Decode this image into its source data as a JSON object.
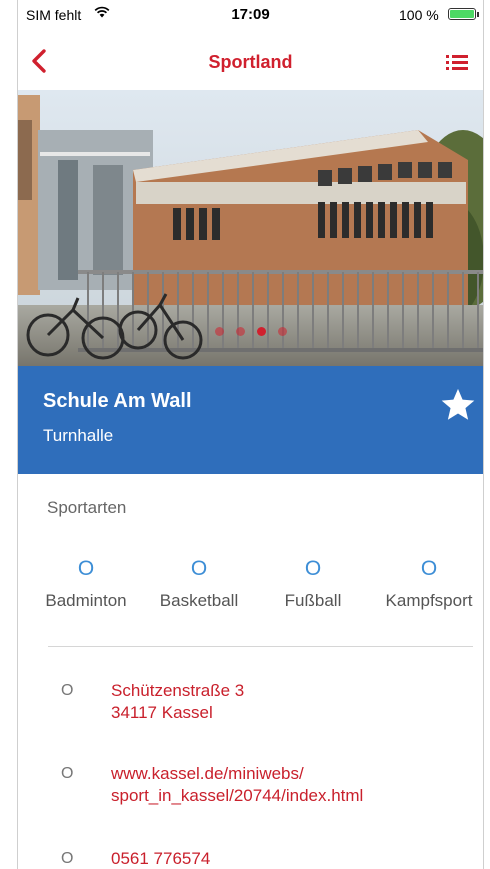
{
  "status_bar": {
    "carrier": "SIM fehlt",
    "wifi_icon": "wifi-icon",
    "time": "17:09",
    "battery": "100 %",
    "battery_level": 1.0
  },
  "nav": {
    "back_icon": "chevron-left-icon",
    "title": "Sportland",
    "menu_icon": "list-icon"
  },
  "hero": {
    "slide_count": 4,
    "active_slide": 3
  },
  "venue": {
    "name": "Schule Am Wall",
    "type": "Turnhalle",
    "favorite_icon": "star-icon"
  },
  "sports": {
    "heading": "Sportarten",
    "items": [
      {
        "icon": "O",
        "label": "Badminton"
      },
      {
        "icon": "O",
        "label": "Basketball"
      },
      {
        "icon": "O",
        "label": "Fußball"
      },
      {
        "icon": "O",
        "label": "Kampfsport"
      }
    ]
  },
  "contact": {
    "address": {
      "icon": "O",
      "text": "Schützenstraße 3\n34117 Kassel"
    },
    "website": {
      "icon": "O",
      "text": "www.kassel.de/miniwebs/\nsport_in_kassel/20744/index.html"
    },
    "phone": {
      "icon": "O",
      "text": "0561 776574"
    }
  },
  "colors": {
    "accent_red": "#d0202e",
    "band_blue": "#2f6ebb",
    "sport_icon_blue": "#3d8ed6"
  }
}
